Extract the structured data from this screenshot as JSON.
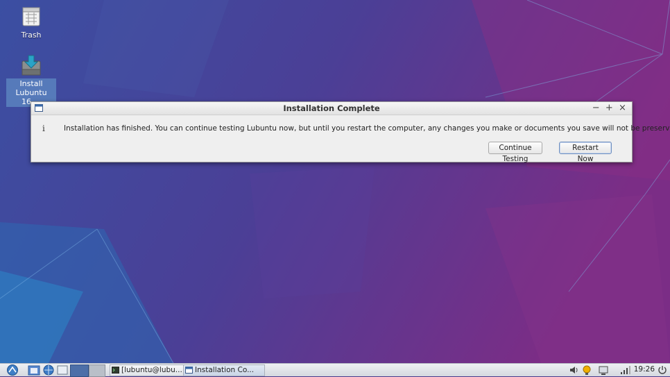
{
  "desktop": {
    "icons": [
      {
        "label": "Trash",
        "icon": "trash-icon"
      },
      {
        "label": "Install\nLubuntu 16....",
        "icon": "installer-icon"
      }
    ]
  },
  "dialog": {
    "title": "Installation Complete",
    "info_glyph": "i",
    "message": "Installation has finished.  You can continue testing Lubuntu now, but until you restart the computer, any changes you make or documents you save will not be preserved.",
    "controls": {
      "minimize": "−",
      "maximize": "+",
      "close": "×"
    },
    "buttons": {
      "continue_label": "Continue Testing",
      "restart_label": "Restart Now"
    }
  },
  "taskbar": {
    "tasks": [
      {
        "label": "[lubuntu@lubu...",
        "icon": "terminal-icon"
      },
      {
        "label": "Installation Co...",
        "icon": "window-icon"
      }
    ],
    "clock": "19:26"
  },
  "colors": {
    "accent": "#6f8fbf",
    "wallpaper_left": "#3a56a8",
    "wallpaper_right": "#7a2f86"
  }
}
